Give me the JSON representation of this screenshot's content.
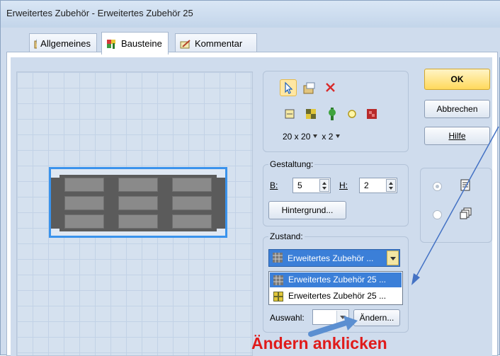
{
  "window": {
    "title": "Erweitertes Zubehör - Erweitertes Zubehör 25"
  },
  "tabs": [
    {
      "label": "Allgemeines",
      "icon": "general-icon"
    },
    {
      "label": "Bausteine",
      "icon": "blocks-icon"
    },
    {
      "label": "Kommentar",
      "icon": "comment-icon"
    }
  ],
  "tools": {
    "grid_size": "20 x 20",
    "zoom": "x 2"
  },
  "buttons": {
    "ok": "OK",
    "cancel": "Abbrechen",
    "help": "Hilfe"
  },
  "gestaltung": {
    "label": "Gestaltung:",
    "width_label": "B:",
    "width_value": "5",
    "height_label": "H:",
    "height_value": "2",
    "background_button": "Hintergrund..."
  },
  "zustand": {
    "label": "Zustand:",
    "selected": "Erweitertes Zubehör ...",
    "options": [
      "Erweitertes Zubehör 25 ...",
      "Erweitertes Zubehör 25 ..."
    ]
  },
  "auswahl": {
    "label": "Auswahl:",
    "change_button": "Ändern..."
  },
  "annotation": {
    "text": "Ändern anklicken",
    "color": "#e01b1b"
  },
  "colors": {
    "accent": "#3a93ec",
    "ok_button": "#ffd95c",
    "selection": "#3b7fd8"
  }
}
